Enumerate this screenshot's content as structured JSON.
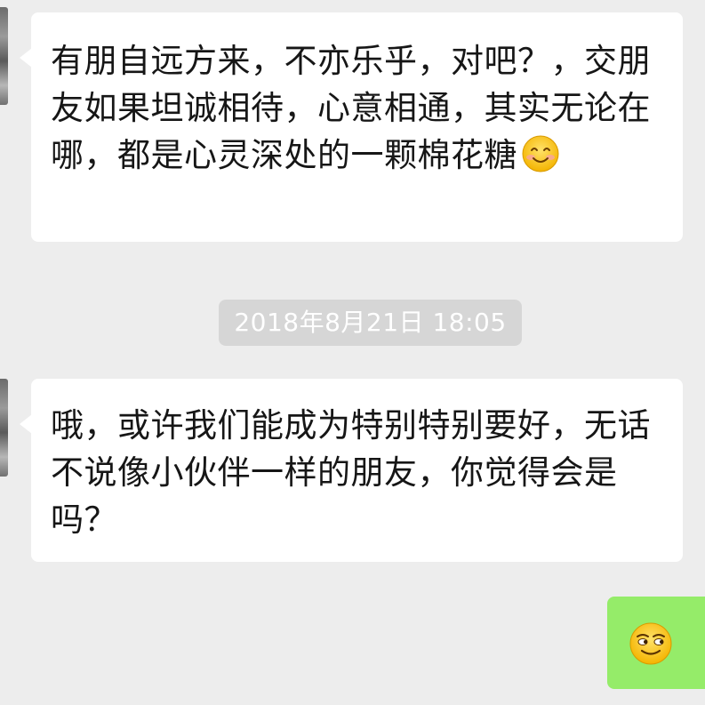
{
  "messages": [
    {
      "side": "incoming",
      "text": "有朋自远方来，不亦乐乎，对吧？，交朋友如果坦诚相待，心意相通，其实无论在哪，都是心灵深处的一颗棉花糖",
      "emoji": "smile-icon"
    },
    {
      "side": "incoming",
      "text": "哦，或许我们能成为特别特别要好，无话不说像小伙伴一样的朋友，你觉得会是吗？"
    },
    {
      "side": "outgoing",
      "emoji": "sly-smile-icon"
    }
  ],
  "timestamp": "2018年8月21日 18:05",
  "colors": {
    "background": "#ededed",
    "incoming_bubble": "#ffffff",
    "outgoing_bubble": "#95ec69",
    "timestamp_pill": "#d6d6d6"
  }
}
